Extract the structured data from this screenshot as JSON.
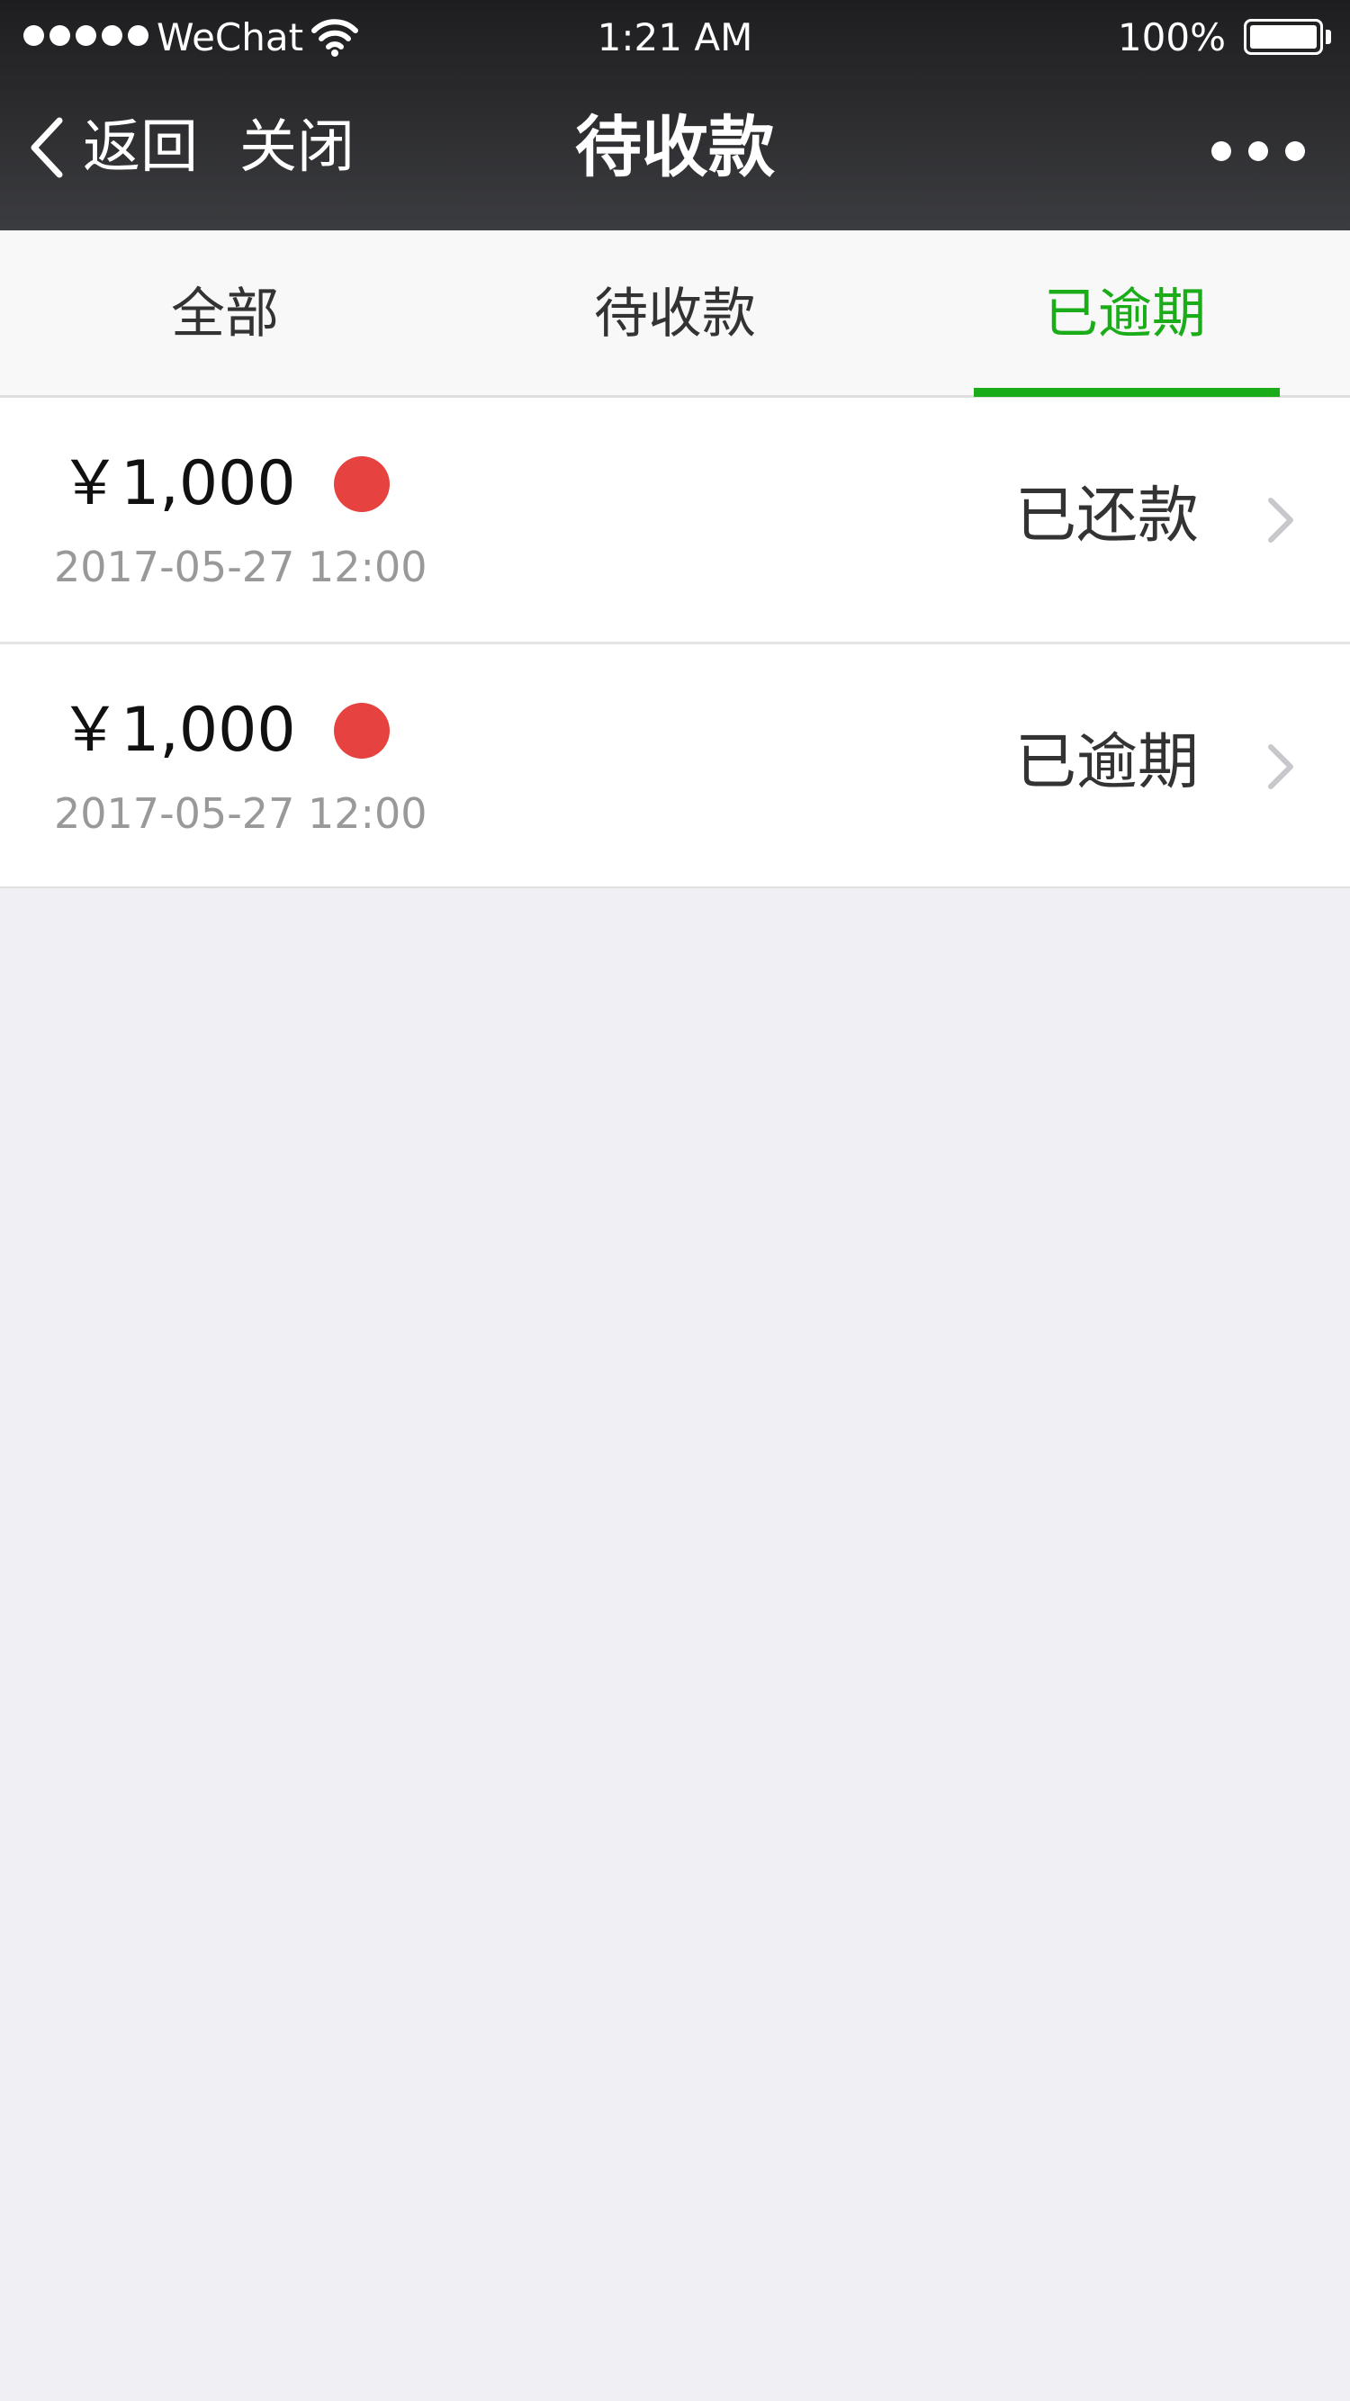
{
  "status_bar": {
    "carrier": "WeChat",
    "time": "1:21 AM",
    "battery": "100%",
    "signal_icon": "signal-dots-icon",
    "wifi_icon": "wifi-icon",
    "battery_icon": "battery-icon",
    "battery_level": 1.0
  },
  "nav": {
    "back_label": "返回",
    "close_label": "关闭",
    "title": "待收款",
    "back_icon": "chevron-left-icon",
    "more_icon": "more-dots-icon"
  },
  "tabs": [
    {
      "label": "全部",
      "active": false
    },
    {
      "label": "待收款",
      "active": false
    },
    {
      "label": "已逾期",
      "active": true
    }
  ],
  "items": [
    {
      "amount": "￥1,000",
      "datetime": "2017-05-27 12:00",
      "status": "已还款",
      "dot_color": "#e64340"
    },
    {
      "amount": "￥1,000",
      "datetime": "2017-05-27 12:00",
      "status": "已逾期",
      "dot_color": "#e64340"
    }
  ],
  "colors": {
    "accent": "#1aad19",
    "dot": "#e64340",
    "header_bg": "#2b2b2e",
    "page_bg": "#efeff4"
  }
}
